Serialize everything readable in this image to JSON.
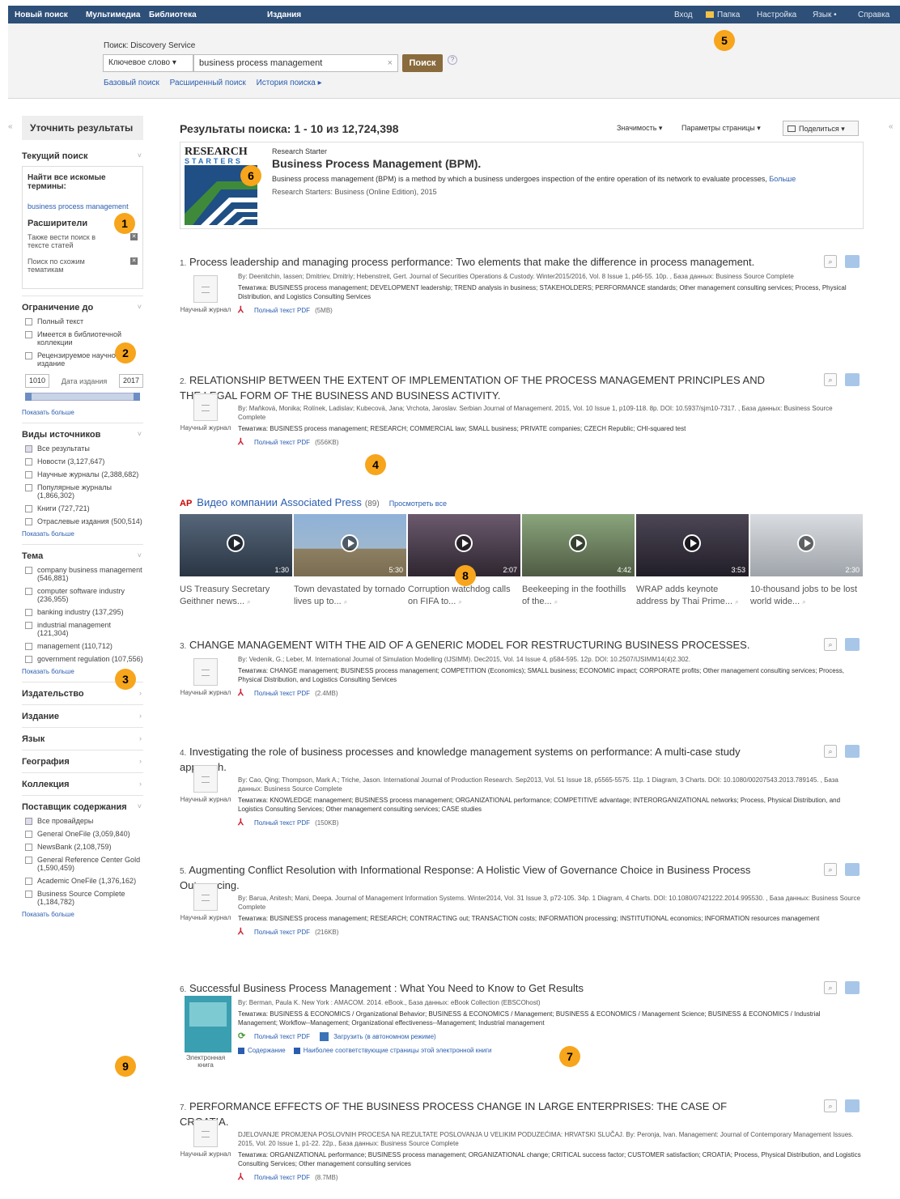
{
  "topnav": {
    "left": [
      "Новый поиск",
      "Мультимедиа",
      "Библиотека",
      "Издания"
    ],
    "right": [
      "Вход",
      "Папка",
      "Настройка",
      "Язык •",
      "Справка"
    ]
  },
  "search": {
    "service_label": "Поиск: Discovery Service",
    "field": "Ключевое слово",
    "query": "business process management",
    "button": "Поиск",
    "help": "?",
    "links": [
      "Базовый поиск",
      "Расширенный поиск",
      "История поиска ▸"
    ]
  },
  "sidebar": {
    "refine_title": "Уточнить результаты",
    "current_search": "Текущий поиск",
    "find_all": "Найти все искомые термины:",
    "term": "business process management",
    "expanders": "Расширители",
    "exp1": "Также вести поиск в тексте статей",
    "exp2": "Поиск по схожим тематикам",
    "limit_to": "Ограничение до",
    "limits": [
      "Полный текст",
      "Имеется в библиотечной коллекции",
      "Рецензируемое научное издание"
    ],
    "date_from": "1010",
    "date_label": "Дата издания",
    "date_to": "2017",
    "show_more": "Показать больше",
    "source_types": "Виды источников",
    "sources": [
      "Все результаты",
      "Новости (3,127,647)",
      "Научные журналы (2,388,682)",
      "Популярные журналы (1,866,302)",
      "Книги (727,721)",
      "Отраслевые издания (500,514)"
    ],
    "subject": "Тема",
    "subjects": [
      "company business management (546,881)",
      "computer software industry (236,955)",
      "banking industry (137,295)",
      "industrial management (121,304)",
      "management (110,712)",
      "government regulation (107,556)"
    ],
    "facets": [
      "Издательство",
      "Издание",
      "Язык",
      "География",
      "Коллекция"
    ],
    "provider": "Поставщик содержания",
    "providers": [
      "Все провайдеры",
      "General OneFile (3,059,840)",
      "NewsBank (2,108,759)",
      "General Reference Center Gold (1,590,459)",
      "Academic OneFile (1,376,162)",
      "Business Source Complete (1,184,782)"
    ]
  },
  "results": {
    "header": "Результаты поиска: 1 - 10 из 12,724,398",
    "sort": "Значимость ▾",
    "page_opts": "Параметры страницы ▾",
    "share": "Поделиться ▾"
  },
  "research_starter": {
    "logo_line1": "RESEARCH",
    "logo_line2": "STARTERS",
    "label": "Research Starter",
    "title": "Business Process Management (BPM).",
    "desc": "Business process management (BPM) is a method by which a business undergoes inspection of the entire operation of its network to evaluate processes,",
    "more": "Больше",
    "source": "Research Starters: Business (Online Edition), 2015"
  },
  "items": [
    {
      "num": "1.",
      "title": "Process leadership and managing process performance: Two elements that make the difference in process management.",
      "meta": "By: Deenitchin, Iassen; Dmitriev, Dmitriy; Hebenstreit, Gert. Journal of Securities Operations & Custody. Winter2015/2016, Vol. 8 Issue 1, p46-55. 10p. , База данных: Business Source Complete",
      "subj": "Тематика: BUSINESS process management; DEVELOPMENT leadership; TREND analysis in business; STAKEHOLDERS; PERFORMANCE standards; Other management consulting services; Process, Physical Distribution, and Logistics Consulting Services",
      "type": "Научный журнал",
      "pdf": "Полный текст PDF",
      "size": "(5MB)"
    },
    {
      "num": "2.",
      "title": "RELATIONSHIP BETWEEN THE EXTENT OF IMPLEMENTATION OF THE PROCESS MANAGEMENT PRINCIPLES AND THE LEGAL FORM OF THE BUSINESS AND BUSINESS ACTIVITY.",
      "meta": "By: Maňková, Monika; Rolínek, Ladislav; Kubecová, Jana; Vrchota, Jaroslav. Serbian Journal of Management. 2015, Vol. 10 Issue 1, p109-118. 8p. DOI: 10.5937/sjm10-7317. , База данных: Business Source Complete",
      "subj": "Тематика: BUSINESS process management; RESEARCH; COMMERCIAL law; SMALL business; PRIVATE companies; CZECH Republic; CHI-squared test",
      "type": "Научный журнал",
      "pdf": "Полный текст PDF",
      "size": "(556KB)"
    },
    {
      "num": "3.",
      "title": "CHANGE MANAGEMENT WITH THE AID OF A GENERIC MODEL FOR RESTRUCTURING BUSINESS PROCESSES.",
      "meta": "By: Vedenik, G.; Leber, M. International Journal of Simulation Modelling (IJSIMM). Dec2015, Vol. 14 Issue 4, p584-595. 12p. DOI: 10.2507/IJSIMM14(4)2.302.",
      "subj": "Тематика: CHANGE management; BUSINESS process management; COMPETITION (Economics); SMALL business; ECONOMIC impact; CORPORATE profits; Other management consulting services; Process, Physical Distribution, and Logistics Consulting Services",
      "type": "Научный журнал",
      "pdf": "Полный текст PDF",
      "size": "(2.4MB)"
    },
    {
      "num": "4.",
      "title": "Investigating the role of business processes and knowledge management systems on performance: A multi-case study approach.",
      "meta": "By: Cao, Qing; Thompson, Mark A.; Triche, Jason. International Journal of Production Research. Sep2013, Vol. 51 Issue 18, p5565-5575. 11p. 1 Diagram, 3 Charts. DOI: 10.1080/00207543.2013.789145. , База данных: Business Source Complete",
      "subj": "Тематика: KNOWLEDGE management; BUSINESS process management; ORGANIZATIONAL performance; COMPETITIVE advantage; INTERORGANIZATIONAL networks; Process, Physical Distribution, and Logistics Consulting Services; Other management consulting services; CASE studies",
      "type": "Научный журнал",
      "pdf": "Полный текст PDF",
      "size": "(150KB)"
    },
    {
      "num": "5.",
      "title": "Augmenting Conflict Resolution with Informational Response: A Holistic View of Governance Choice in Business Process Outsourcing.",
      "meta": "By: Barua, Anitesh; Mani, Deepa. Journal of Management Information Systems. Winter2014, Vol. 31 Issue 3, p72-105. 34p. 1 Diagram, 4 Charts. DOI: 10.1080/07421222.2014.995530. , База данных: Business Source Complete",
      "subj": "Тематика: BUSINESS process management; RESEARCH; CONTRACTING out; TRANSACTION costs; INFORMATION processing; INSTITUTIONAL economics; INFORMATION resources management",
      "type": "Научный журнал",
      "pdf": "Полный текст PDF",
      "size": "(216KB)"
    },
    {
      "num": "6.",
      "title": "Successful Business Process Management : What You Need to Know to Get Results",
      "meta": "By: Berman, Paula K. New York : AMACOM. 2014. eBook., База данных: eBook Collection (EBSCOhost)",
      "subj": "Тематика: BUSINESS & ECONOMICS / Organizational Behavior; BUSINESS & ECONOMICS / Management; BUSINESS & ECONOMICS / Management Science; BUSINESS & ECONOMICS / Industrial Management; Workflow--Management; Organizational effectiveness--Management; Industrial management",
      "type": "Электронная книга",
      "pdf": "Полный текст PDF",
      "download": "Загрузить (в автономном режиме)",
      "toc": "Содержание",
      "relevant": "Наиболее соответствующие страницы этой электронной книги"
    },
    {
      "num": "7.",
      "title": "PERFORMANCE EFFECTS OF THE BUSINESS PROCESS CHANGE IN LARGE ENTERPRISES: THE CASE OF CROATIA.",
      "meta": "DJELOVANJE PROMJENA POSLOVNIH PROCESA NA REZULTATE POSLOVANJA U VELIKIM PODUZEĆIMA: HRVATSKI SLUČAJ. By: Peronja, Ivan. Management: Journal of Contemporary Management Issues. 2015, Vol. 20 Issue 1, p1-22. 22p., База данных: Business Source Complete",
      "subj": "Тематика: ORGANIZATIONAL performance; BUSINESS process management; ORGANIZATIONAL change; CRITICAL success factor; CUSTOMER satisfaction; CROATIA; Process, Physical Distribution, and Logistics Consulting Services; Other management consulting services",
      "type": "Научный журнал",
      "pdf": "Полный текст PDF",
      "size": "(8.7MB)"
    }
  ],
  "video": {
    "ap": "AP",
    "title": "Видео компании Associated Press",
    "count": "(89)",
    "view_all": "Просмотреть все",
    "clips": [
      {
        "dur": "1:30",
        "caption": "US Treasury Secretary Geithner news...",
        "color": "#3b4a5a"
      },
      {
        "dur": "5:30",
        "caption": "Town devastated by tornado lives up to...",
        "color": "#6f8fb5"
      },
      {
        "dur": "2:07",
        "caption": "Corruption watchdog calls on FIFA to...",
        "color": "#4a3d4d"
      },
      {
        "dur": "4:42",
        "caption": "Beekeeping in the foothills of the...",
        "color": "#5f6d52"
      },
      {
        "dur": "3:53",
        "caption": "WRAP adds keynote address by Thai Prime...",
        "color": "#36323d"
      },
      {
        "dur": "2:30",
        "caption": "10-thousand jobs to be lost world wide...",
        "color": "#bfc3c8"
      }
    ]
  },
  "markers": [
    "1",
    "2",
    "3",
    "4",
    "5",
    "6",
    "7",
    "8",
    "9"
  ]
}
